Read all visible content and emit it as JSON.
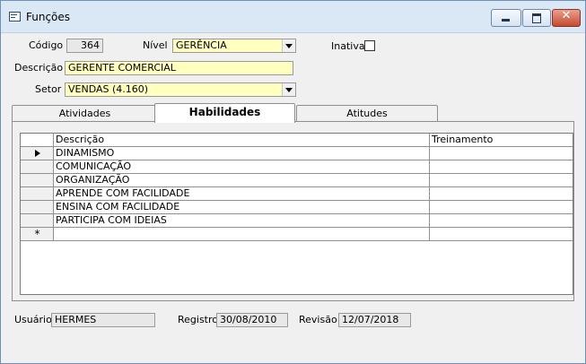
{
  "window": {
    "title": "Funções"
  },
  "form": {
    "codigo_label": "Código",
    "codigo_value": "364",
    "nivel_label": "Nível",
    "nivel_value": "GERÊNCIA",
    "inativa_label": "Inativa",
    "inativa_checked": false,
    "descricao_label": "Descrição",
    "descricao_value": "GERENTE COMERCIAL",
    "setor_label": "Setor",
    "setor_value": "VENDAS (4.160)"
  },
  "tabs": [
    {
      "label": "Atividades",
      "active": false
    },
    {
      "label": "Habilidades",
      "active": true
    },
    {
      "label": "Atitudes",
      "active": false
    }
  ],
  "grid": {
    "columns": [
      "Descrição",
      "Treinamento"
    ],
    "rows": [
      {
        "descricao": "DINAMISMO",
        "treinamento": ""
      },
      {
        "descricao": "COMUNICAÇÃO",
        "treinamento": ""
      },
      {
        "descricao": "ORGANIZAÇÃO",
        "treinamento": ""
      },
      {
        "descricao": "APRENDE COM FACILIDADE",
        "treinamento": ""
      },
      {
        "descricao": "ENSINA COM FACILIDADE",
        "treinamento": ""
      },
      {
        "descricao": "PARTICIPA COM IDEIAS",
        "treinamento": ""
      }
    ],
    "new_row_marker": "*"
  },
  "footer": {
    "usuario_label": "Usuário",
    "usuario_value": "HERMES",
    "registro_label": "Registro",
    "registro_value": "30/08/2010",
    "revisao_label": "Revisão",
    "revisao_value": "12/07/2018"
  }
}
